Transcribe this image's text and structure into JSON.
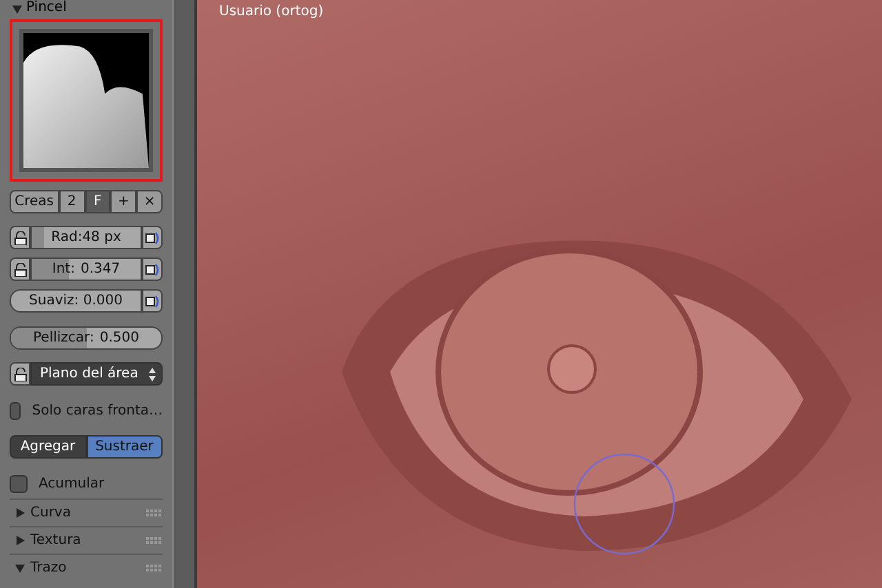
{
  "panel": {
    "header": {
      "label": "Pincel",
      "expanded": true
    },
    "brush_tools": [
      {
        "kind": "text",
        "label": "Creas"
      },
      {
        "kind": "text",
        "label": "2"
      },
      {
        "kind": "text",
        "label": "F"
      },
      {
        "kind": "add",
        "label": "+"
      },
      {
        "kind": "remove",
        "label": "×"
      }
    ],
    "sliders": [
      {
        "label": "Rad:48 px",
        "lock": true,
        "pressure": true,
        "level": 0.12
      },
      {
        "label": "Int:",
        "value": "0.347",
        "lock": true,
        "pressure": true,
        "level": 0.347
      },
      {
        "label": "Suaviz: 0.000",
        "lock": false,
        "pressure": true
      },
      {
        "label": "Pellizcar:",
        "value": "0.500",
        "lock": false,
        "pressure": false,
        "level": 0.5
      }
    ],
    "plane": {
      "value": "Plano del área"
    },
    "front_faces": {
      "label": "Solo caras fronta…",
      "checked": false
    },
    "direction": [
      {
        "label": "Agregar",
        "selected": false
      },
      {
        "label": "Sustraer",
        "selected": true
      }
    ],
    "accumulate": {
      "label": "Acumular",
      "checked": false
    },
    "sections": [
      {
        "label": "Curva",
        "expanded": false
      },
      {
        "label": "Textura",
        "expanded": false
      },
      {
        "label": "Trazo",
        "expanded": true
      }
    ]
  },
  "viewport": {
    "label": "Usuario (ortog)"
  }
}
